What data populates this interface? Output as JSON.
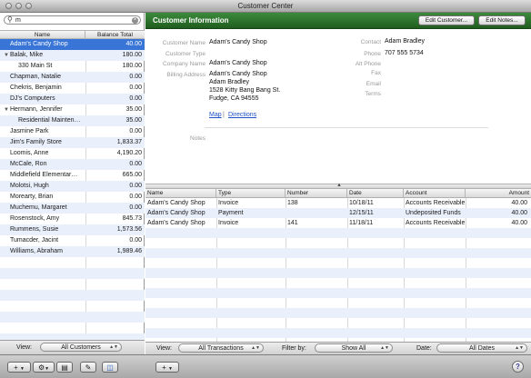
{
  "window": {
    "title": "Customer Center"
  },
  "search": {
    "value": "m"
  },
  "customer_list": {
    "col_name": "Name",
    "col_balance": "Balance Total",
    "rows": [
      {
        "name": "Adam's Candy Shop",
        "balance": "40.00",
        "selected": true
      },
      {
        "name": "Balak, Mike",
        "balance": "180.00",
        "expanded": true
      },
      {
        "name": "330 Main St",
        "balance": "180.00",
        "indent": true
      },
      {
        "name": "Chapman, Natalie",
        "balance": "0.00"
      },
      {
        "name": "Chekris, Benjamin",
        "balance": "0.00"
      },
      {
        "name": "DJ's Computers",
        "balance": "0.00"
      },
      {
        "name": "Hermann, Jennifer",
        "balance": "35.00",
        "expanded": true
      },
      {
        "name": "Residential Mainten…",
        "balance": "35.00",
        "indent": true
      },
      {
        "name": "Jasmine Park",
        "balance": "0.00"
      },
      {
        "name": "Jim's Family Store",
        "balance": "1,833.37"
      },
      {
        "name": "Loomis, Anne",
        "balance": "4,190.20"
      },
      {
        "name": "McCale, Ron",
        "balance": "0.00"
      },
      {
        "name": "Middlefield Elementar…",
        "balance": "665.00"
      },
      {
        "name": "Molotsi, Hugh",
        "balance": "0.00"
      },
      {
        "name": "Morearty, Brian",
        "balance": "0.00"
      },
      {
        "name": "Muchemu, Margaret",
        "balance": "0.00"
      },
      {
        "name": "Rosenstock, Amy",
        "balance": "845.73"
      },
      {
        "name": "Rummens, Susie",
        "balance": "1,573.56"
      },
      {
        "name": "Tumacder, Jacint",
        "balance": "0.00"
      },
      {
        "name": "Williams, Abraham",
        "balance": "1,989.46"
      }
    ]
  },
  "left_footer": {
    "view_label": "View:",
    "view_value": "All Customers"
  },
  "info": {
    "header": "Customer Information",
    "edit_customer": "Edit Customer...",
    "edit_notes": "Edit Notes...",
    "labels": {
      "customer_name": "Customer Name",
      "customer_type": "Customer Type",
      "company_name": "Company Name",
      "billing_address": "Billing Address",
      "contact": "Contact",
      "phone": "Phone",
      "alt_phone": "Alt Phone",
      "fax": "Fax",
      "email": "Email",
      "terms": "Terms",
      "notes": "Notes"
    },
    "customer_name": "Adam's Candy Shop",
    "company_name": "Adam's Candy Shop",
    "address1": "Adam's Candy Shop",
    "address2": "Adam Bradley",
    "address3": "1528 Kitty Bang Bang St.",
    "address4": "Fudge, CA 94555",
    "contact": "Adam Bradley",
    "phone": "707 555 5734",
    "map_link": "Map",
    "separator": "|",
    "directions_link": "Directions"
  },
  "transactions": {
    "columns": [
      "Name",
      "Type",
      "Number",
      "Date",
      "Account",
      "Amount"
    ],
    "rows": [
      {
        "name": "Adam's Candy Shop",
        "type": "Invoice",
        "number": "138",
        "date": "10/18/11",
        "account": "Accounts Receivable",
        "amount": "40.00"
      },
      {
        "name": "Adam's Candy Shop",
        "type": "Payment",
        "number": "",
        "date": "12/15/11",
        "account": "Undeposited Funds",
        "amount": "40.00"
      },
      {
        "name": "Adam's Candy Shop",
        "type": "Invoice",
        "number": "141",
        "date": "11/18/11",
        "account": "Accounts Receivable",
        "amount": "40.00"
      }
    ]
  },
  "right_footer": {
    "view_label": "View:",
    "view_value": "All Transactions",
    "filter_label": "Filter by:",
    "filter_value": "Show All",
    "date_label": "Date:",
    "date_value": "All Dates"
  },
  "toolbar": {
    "add": "+",
    "help": "?"
  }
}
